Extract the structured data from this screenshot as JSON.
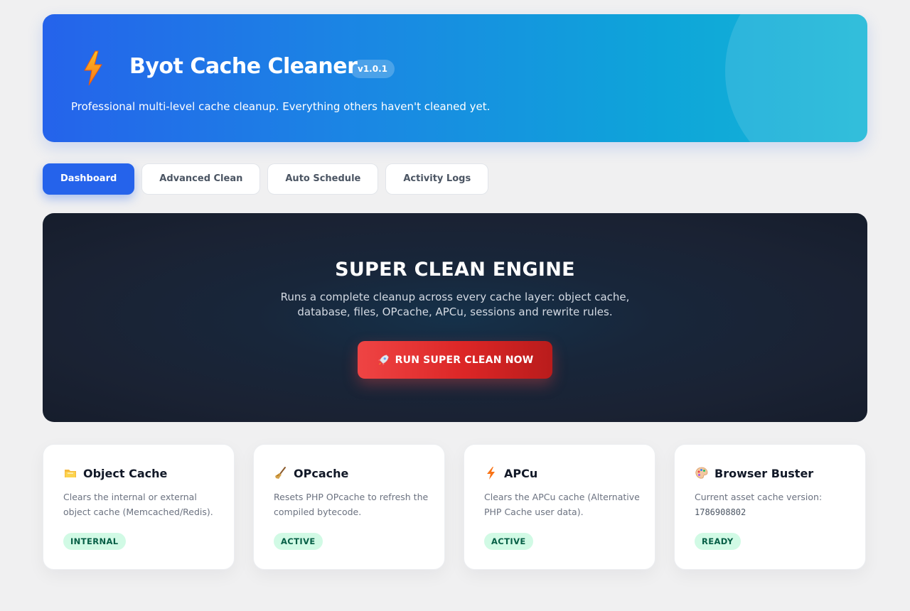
{
  "header": {
    "title": "Byot Cache Cleaner",
    "version": "v1.0.1",
    "description": "Professional multi-level cache cleanup. Everything others haven't cleaned yet."
  },
  "tabs": [
    {
      "label": "Dashboard",
      "active": true
    },
    {
      "label": "Advanced Clean",
      "active": false
    },
    {
      "label": "Auto Schedule",
      "active": false
    },
    {
      "label": "Activity Logs",
      "active": false
    }
  ],
  "engine": {
    "title": "SUPER CLEAN ENGINE",
    "description": "Runs a complete cleanup across every cache layer: object cache, database, files, OPcache, APCu, sessions and rewrite rules.",
    "button_label": "RUN SUPER CLEAN NOW"
  },
  "cards": [
    {
      "icon": "folder-icon",
      "title": "Object Cache",
      "description": "Clears the internal or external object cache (Memcached/Redis).",
      "badge": "INTERNAL"
    },
    {
      "icon": "broom-icon",
      "title": "OPcache",
      "description": "Resets PHP OPcache to refresh the compiled bytecode.",
      "badge": "ACTIVE"
    },
    {
      "icon": "lightning-icon",
      "title": "APCu",
      "description": "Clears the APCu cache (Alternative PHP Cache user data).",
      "badge": "ACTIVE"
    },
    {
      "icon": "palette-icon",
      "title": "Browser Buster",
      "description": "Current asset cache version:",
      "version_value": "1786908802",
      "badge": "READY"
    }
  ],
  "colors": {
    "primary": "#2563eb",
    "danger": "#ef4444",
    "success_bg": "#d1fae5",
    "success_text": "#065f46"
  }
}
